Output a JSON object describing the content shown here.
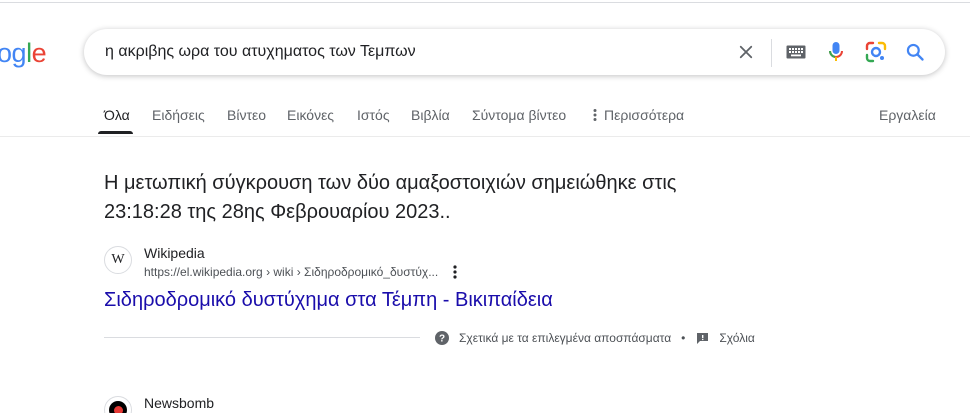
{
  "logo": {
    "part1": "o",
    "part2": "g",
    "part3": "l",
    "part4": "e"
  },
  "search": {
    "query": "η ακριβης ωρα του ατυχηματος των Τεμπων",
    "icons": [
      "clear-icon",
      "keyboard-icon",
      "microphone-icon",
      "lens-icon",
      "search-icon"
    ]
  },
  "tabs": {
    "items": [
      {
        "label": "Όλα",
        "active": true
      },
      {
        "label": "Ειδήσεις"
      },
      {
        "label": "Βίντεο"
      },
      {
        "label": "Εικόνες"
      },
      {
        "label": "Ιστός"
      },
      {
        "label": "Βιβλία"
      },
      {
        "label": "Σύντομα βίντεο"
      },
      {
        "label": "Περισσότερα"
      }
    ],
    "tools": "Εργαλεία"
  },
  "featured_snippet": {
    "answer_line1": "Η μετωπική σύγκρουση των δύο αμαξοστοιχιών σημειώθηκε στις",
    "answer_line2": "23:18:28 της 28ης Φεβρουαρίου 2023..",
    "source": {
      "favicon_letter": "W",
      "name": "Wikipedia",
      "url": "https://el.wikipedia.org › wiki › Σιδηροδρομικό_δυστύχ..."
    },
    "link_title": "Σιδηροδρομικό δυστύχημα στα Τέμπη - Βικιπαίδεια",
    "about_label": "Σχετικά με τα επιλεγμένα αποσπάσματα",
    "separator": "•",
    "feedback_label": "Σχόλια"
  },
  "next_result": {
    "name": "Newsbomb"
  },
  "colors": {
    "link": "#1a0dab",
    "text": "#202124",
    "muted": "#5f6368",
    "google_blue": "#4285f4",
    "google_red": "#ea4335",
    "google_yellow": "#fbbc05",
    "google_green": "#34a853"
  }
}
